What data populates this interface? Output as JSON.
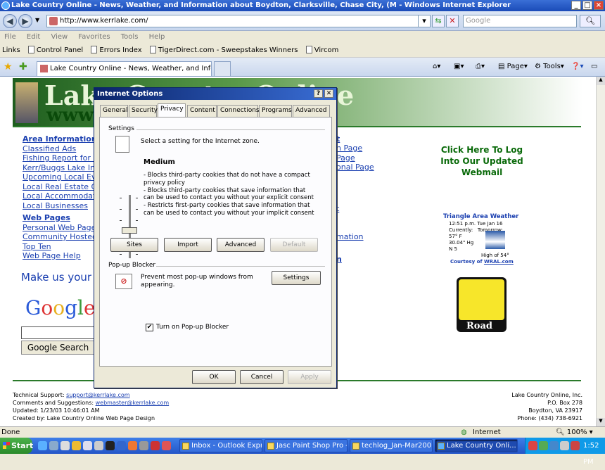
{
  "window": {
    "title": "Lake Country Online - News, Weather, and Information about Boydton, Clarksville, Chase City, (M - Windows Internet Explorer"
  },
  "address": {
    "url": "http://www.kerrlake.com/",
    "search_placeholder": "Google"
  },
  "menu": [
    "File",
    "Edit",
    "View",
    "Favorites",
    "Tools",
    "Help"
  ],
  "links": {
    "label": "Links",
    "items": [
      "Control Panel",
      "Errors Index",
      "TigerDirect.com - Sweepstakes Winners",
      "Vircom"
    ]
  },
  "tabs": {
    "active": "Lake Country Online - News, Weather, and Informati..."
  },
  "toolbar": {
    "page": "Page",
    "tools": "Tools"
  },
  "page": {
    "banner_top": "Lake Country Online",
    "banner_bottom": "www",
    "area_heading": "Area Information",
    "area_links": [
      "Classified Ads",
      "Fishing Report for Ke",
      "Kerr/Buggs Lake Info",
      "Upcoming Local Eve",
      "Local Real Estate Co",
      "Local Accommodatio",
      "Local Businesses"
    ],
    "web_heading": "Web Pages",
    "web_links": [
      "Personal Web Pages",
      "Community Hosted W",
      "Top Ten",
      "Web Page Help"
    ],
    "make_us": "Make us your h",
    "right_col": [
      "t",
      "n Page",
      "Page",
      "onal Page",
      "t",
      "mation",
      "n"
    ],
    "webmail": "Click Here To Log Into Our Updated Webmail",
    "weather": {
      "title": "Triangle Area Weather",
      "time": "12:51 p.m. Tue Jan 16",
      "currently": "Currently:",
      "tomorrow": "Tomorrow:",
      "temp": "57° F",
      "pressure": "30.04\" Hg",
      "wind": "N 5",
      "high": "High of 54°",
      "courtesy": "Courtesy of",
      "wral": "WRAL.com"
    },
    "yellow_label": "Road",
    "google": "Google",
    "google_search": "Google Search",
    "footer_left": [
      "Technical Support:",
      "support@kerrlake.com",
      "Comments and Suggestions:",
      "webmaster@kerrlake.com",
      "Updated: 1/23/03 10:46:01 AM",
      "Created by: Lake Country Online Web Page Design"
    ],
    "footer_right": [
      "Lake Country Online, Inc.",
      "P.O. Box 278",
      "Boydton, VA 23917",
      "Phone: (434) 738-6921"
    ]
  },
  "dialog": {
    "title": "Internet Options",
    "tabs": [
      "General",
      "Security",
      "Privacy",
      "Content",
      "Connections",
      "Programs",
      "Advanced"
    ],
    "settings_label": "Settings",
    "zone_text": "Select a setting for the Internet zone.",
    "level": "Medium",
    "level_desc": [
      "- Blocks third-party cookies that do not have a compact privacy policy",
      "- Blocks third-party cookies that save information that can be used to contact you without your explicit consent",
      "- Restricts first-party cookies that save information that can be used to contact you without your implicit consent"
    ],
    "buttons": [
      "Sites",
      "Import",
      "Advanced",
      "Default"
    ],
    "popup_label": "Pop-up Blocker",
    "popup_text": "Prevent most pop-up windows from appearing.",
    "popup_settings": "Settings",
    "popup_checkbox": "Turn on Pop-up Blocker",
    "ok": "OK",
    "cancel": "Cancel",
    "apply": "Apply"
  },
  "status": {
    "text": "Done",
    "zone": "Internet",
    "zoom": "100%"
  },
  "taskbar": {
    "start": "Start",
    "tasks": [
      "Inbox - Outlook Expr...",
      "Jasc Paint Shop Pro -...",
      "techlog_Jan-Mar200...",
      "Lake Country Onli..."
    ],
    "clock": "1:52 PM"
  }
}
